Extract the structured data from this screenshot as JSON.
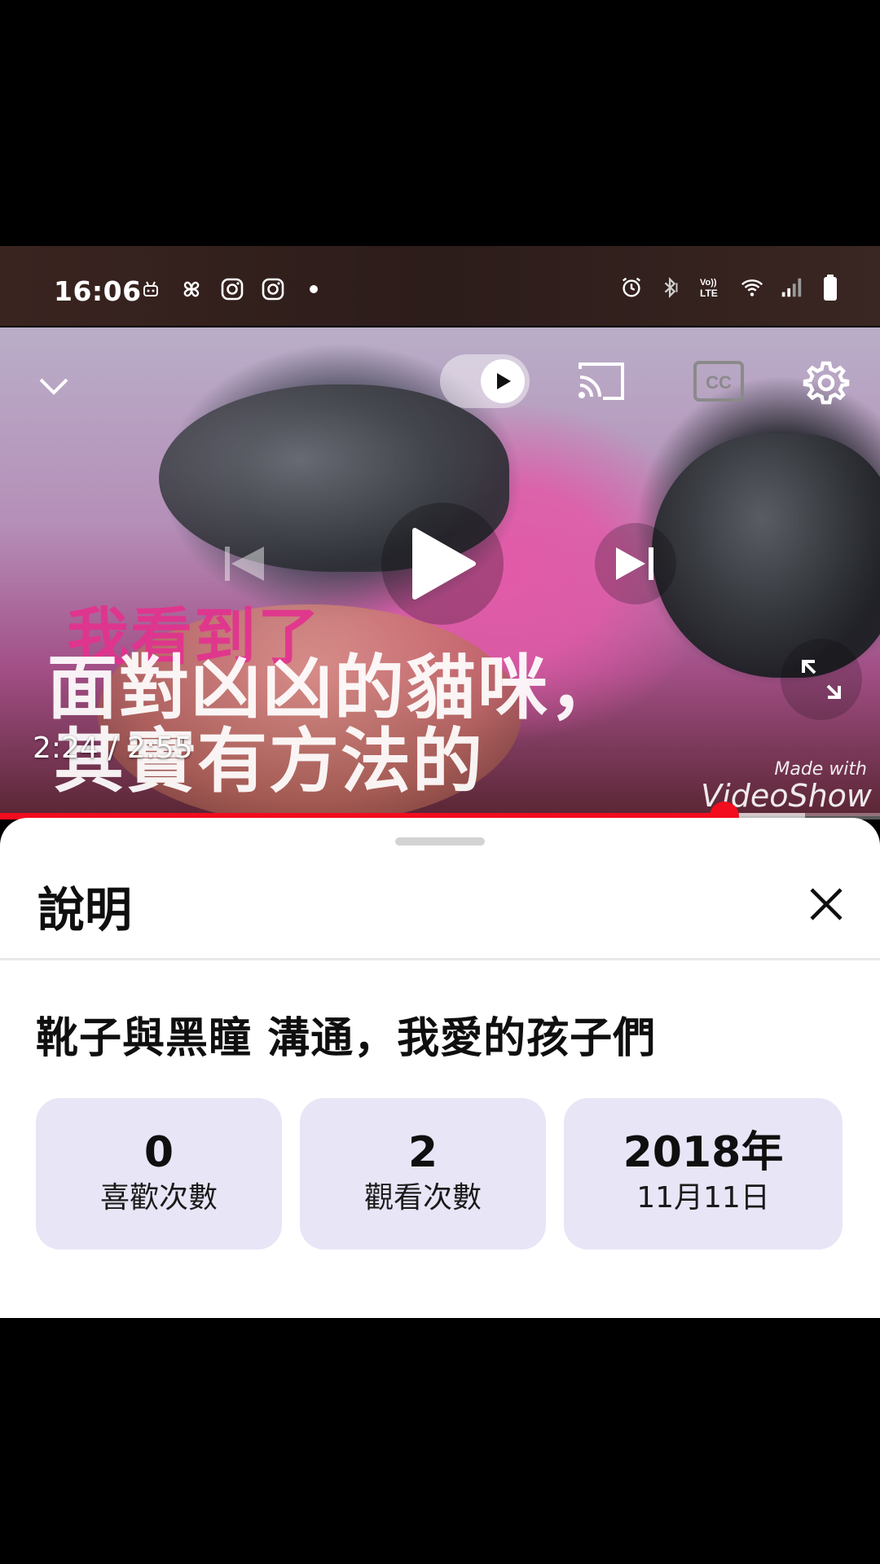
{
  "status_bar": {
    "time": "16:06",
    "left_icons": [
      "android-debug-icon",
      "pinwheel-icon",
      "instagram-icon",
      "instagram-icon",
      "dot-icon"
    ],
    "right_icons": [
      "alarm-icon",
      "bluetooth-icon",
      "volte-icon",
      "wifi-icon",
      "signal-icon",
      "battery-icon"
    ],
    "volte_text": "Vo)) LTE"
  },
  "player": {
    "subtitle_pink": "我看到了",
    "subtitle_line1": "面對凶凶的貓咪，",
    "subtitle_line2": "其實有方法的",
    "watermark_small": "Made with",
    "watermark_big": "VideoShow",
    "timecode": "2:24 / 2:55",
    "progress": 0.823,
    "buffered": 0.915,
    "cc_label": "CC",
    "accent_color": "#f20c1e"
  },
  "sheet": {
    "title": "說明",
    "video_title": "靴子與黑瞳 溝通，我愛的孩子們",
    "stats": [
      {
        "value": "0",
        "label": "喜歡次數"
      },
      {
        "value": "2",
        "label": "觀看次數"
      },
      {
        "value": "2018年",
        "label": "11月11日"
      }
    ],
    "stat_bg": "#e8e5f7"
  }
}
